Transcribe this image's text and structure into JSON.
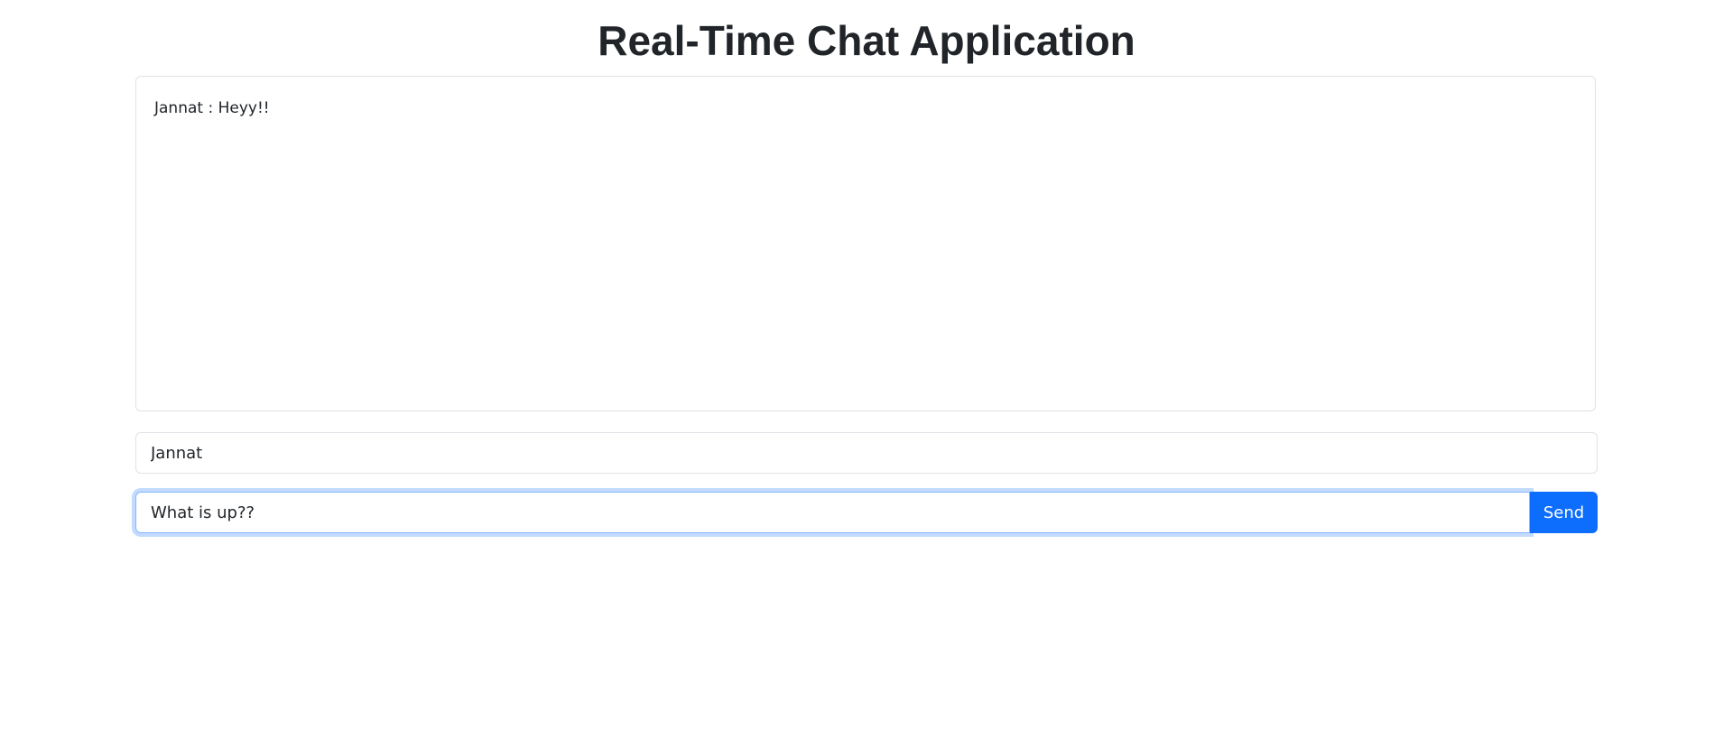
{
  "header": {
    "title": "Real-Time Chat Application"
  },
  "chat": {
    "messages": [
      {
        "text": "Jannat : Heyy!!"
      }
    ]
  },
  "form": {
    "name_value": "Jannat",
    "message_value": "What is up??",
    "send_label": "Send"
  },
  "colors": {
    "accent": "#0d6efd",
    "border": "#dee2e6"
  }
}
